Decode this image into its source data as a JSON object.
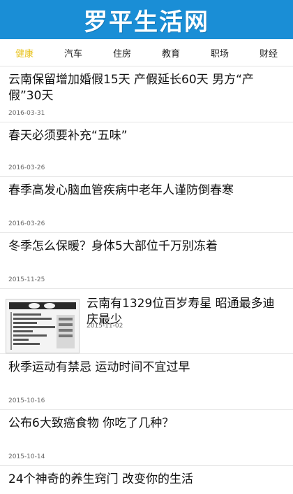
{
  "header": {
    "title": "罗平生活网"
  },
  "tabs": [
    {
      "label": "健康"
    },
    {
      "label": "汽车"
    },
    {
      "label": "住房"
    },
    {
      "label": "教育"
    },
    {
      "label": "职场"
    },
    {
      "label": "财经"
    }
  ],
  "articles": [
    {
      "title": "云南保留增加婚假15天 产假延长60天 男方“产假”30天",
      "date": "2016-03-31"
    },
    {
      "title": "春天必须要补充“五味”",
      "date": "2016-03-26"
    },
    {
      "title": "春季高发心脑血管疾病中老年人谨防倒春寒",
      "date": "2016-03-26"
    },
    {
      "title": "冬季怎么保暖？身体5大部位千万别冻着",
      "date": "2015-11-25"
    },
    {
      "title": "云南有1329位百岁寿星 昭通最多迪庆最少",
      "date": "2015-11-02"
    },
    {
      "title": "秋季运动有禁忌 运动时间不宜过早",
      "date": "2015-10-16"
    },
    {
      "title": "公布6大致癌食物 你吃了几种？",
      "date": "2015-10-14"
    },
    {
      "title": "24个神奇的养生窍门 改变你的生活",
      "date": ""
    }
  ],
  "colors": {
    "header_bg": "#1a8ed6",
    "active_tab": "#e8c21a"
  }
}
